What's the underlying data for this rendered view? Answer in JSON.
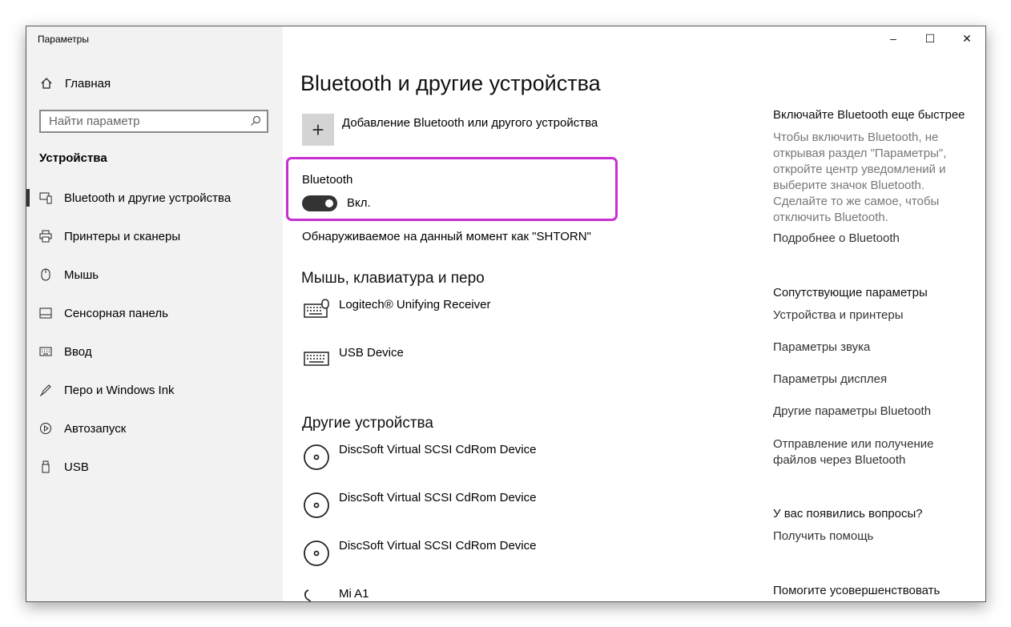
{
  "window": {
    "title": "Параметры"
  },
  "window_controls": {
    "minimize": "–",
    "maximize": "☐",
    "close": "✕"
  },
  "sidebar": {
    "home_label": "Главная",
    "search_placeholder": "Найти параметр",
    "section_title": "Устройства",
    "items": [
      {
        "label": "Bluetooth и другие устройства",
        "icon": "bluetooth-devices-icon",
        "active": true
      },
      {
        "label": "Принтеры и сканеры",
        "icon": "printer-icon"
      },
      {
        "label": "Мышь",
        "icon": "mouse-icon"
      },
      {
        "label": "Сенсорная панель",
        "icon": "touchpad-icon"
      },
      {
        "label": "Ввод",
        "icon": "keyboard-icon"
      },
      {
        "label": "Перо и Windows Ink",
        "icon": "pen-icon"
      },
      {
        "label": "Автозапуск",
        "icon": "autoplay-icon"
      },
      {
        "label": "USB",
        "icon": "usb-icon"
      }
    ]
  },
  "main": {
    "title": "Bluetooth и другие устройства",
    "add_device_label": "Добавление Bluetooth или другого устройства",
    "bluetooth": {
      "title": "Bluetooth",
      "state_label": "Вкл.",
      "on": true
    },
    "discoverable_text": "Обнаруживаемое на данный момент как \"SHTORN\"",
    "mouse_section_title": "Мышь, клавиатура и перо",
    "mouse_devices": [
      {
        "name": "Logitech® Unifying Receiver",
        "icon": "keyboard-mouse-icon"
      },
      {
        "name": "USB Device",
        "icon": "keyboard-icon"
      }
    ],
    "other_section_title": "Другие устройства",
    "other_devices": [
      {
        "name": "DiscSoft Virtual SCSI CdRom Device",
        "icon": "disc-icon"
      },
      {
        "name": "DiscSoft Virtual SCSI CdRom Device",
        "icon": "disc-icon"
      },
      {
        "name": "DiscSoft Virtual SCSI CdRom Device",
        "icon": "disc-icon"
      },
      {
        "name": "Mi A1",
        "icon": "headset-icon"
      }
    ]
  },
  "right_panel": {
    "quick_title": "Включайте Bluetooth еще быстрее",
    "quick_desc": "Чтобы включить Bluetooth, не открывая раздел \"Параметры\", откройте центр уведомлений и выберите значок Bluetooth. Сделайте то же самое, чтобы отключить Bluetooth.",
    "quick_link": "Подробнее о Bluetooth",
    "related_title": "Сопутствующие параметры",
    "related_links": [
      "Устройства и принтеры",
      "Параметры звука",
      "Параметры дисплея",
      "Другие параметры Bluetooth",
      "Отправление или получение файлов через Bluetooth"
    ],
    "questions_title": "У вас появились вопросы?",
    "help_link": "Получить помощь",
    "improve_title": "Помогите усовершенствовать"
  },
  "colors": {
    "highlight": "#c62fd2",
    "sidebar_bg": "#f2f2f2",
    "toggle_on": "#333333"
  }
}
